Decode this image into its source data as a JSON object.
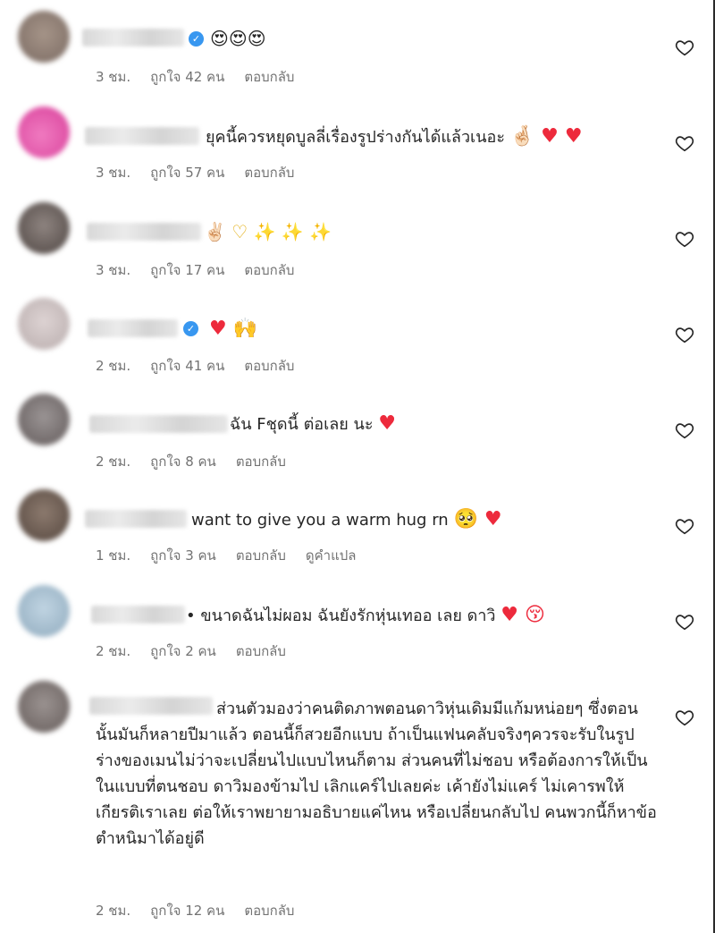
{
  "colors": {
    "verified": "#3897f0",
    "heart": "#ed2a3c",
    "meta_text": "#737373"
  },
  "comments": [
    {
      "text": "",
      "emojis": "😍😍😍",
      "verified": true,
      "time": "3 ชม.",
      "likes": "ถูกใจ 42 คน",
      "reply": "ตอบกลับ",
      "avatar_color": "#8a7a72"
    },
    {
      "text": "ยุคนี้ควรหยุดบูลลี่เรื่องรูปร่างกันได้แล้วเนอะ",
      "emojis": "🤞🏻 ♥ ♥",
      "verified": false,
      "time": "3 ชม.",
      "likes": "ถูกใจ 57 คน",
      "reply": "ตอบกลับ",
      "avatar_color": "#e05aa8"
    },
    {
      "text": "",
      "emojis": "✌🏻 ♡ ✨ ✨ ✨",
      "verified": false,
      "time": "3 ชม.",
      "likes": "ถูกใจ 17 คน",
      "reply": "ตอบกลับ",
      "avatar_color": "#5d5350"
    },
    {
      "text": "",
      "emojis": "♥ 🙌",
      "verified": true,
      "time": "2 ชม.",
      "likes": "ถูกใจ 41 คน",
      "reply": "ตอบกลับ",
      "avatar_color": "#c8bcbc"
    },
    {
      "text": "ฉัน Fชุดนี้ ต่อเลย นะ",
      "emojis": "♥",
      "verified": false,
      "time": "2 ชม.",
      "likes": "ถูกใจ 8 คน",
      "reply": "ตอบกลับ",
      "avatar_color": "#777070"
    },
    {
      "text": "want to give you a warm hug rn",
      "emojis": "🥺 ♥",
      "verified": false,
      "time": "1 ชม.",
      "likes": "ถูกใจ 3 คน",
      "reply": "ตอบกลับ",
      "translate": "ดูคำแปล",
      "avatar_color": "#6e5d52"
    },
    {
      "text": "ขนาดฉันไม่ผอม ฉันยังรักหุ่นเทออ เลย ดาวิ",
      "emojis": "♥  😚",
      "verified": false,
      "time": "2 ชม.",
      "likes": "ถูกใจ 2 คน",
      "reply": "ตอบกลับ",
      "avatar_color": "#a7bfd0"
    },
    {
      "text": "ส่วนตัวมองว่าคนติดภาพตอนดาวิหุ่นเดิมมีแก้มหน่อยๆ ซึ่งตอนนั้นมันก็หลายปีมาแล้ว ตอนนี้ก็สวยอีกแบบ ถ้าเป็นแฟนคลับจริงๆควรจะรับในรูปร่างของเมนไม่ว่าจะเปลี่ยนไปแบบไหนก็ตาม ส่วนคนที่ไม่ชอบ หรือต้องการให้เป็นในแบบที่ตนชอบ ดาวิมองข้ามไป เลิกแคร์ไปเลยค่ะ เค้ายังไม่แคร์ ไม่เคารพให้เกียรติเราเลย ต่อให้เราพยายามอธิบายแค่ไหน หรือเปลี่ยนกลับไป คนพวกนี้ก็หาข้อตำหนิมาได้อยู่ดี",
      "emojis": "",
      "verified": false,
      "time": "2 ชม.",
      "likes": "ถูกใจ 12 คน",
      "reply": "ตอบกลับ",
      "avatar_color": "#7a7370"
    }
  ]
}
